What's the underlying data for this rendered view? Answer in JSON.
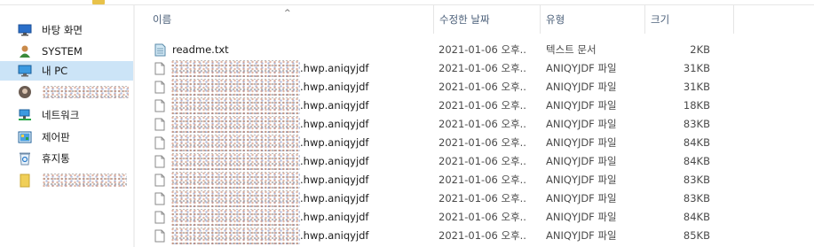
{
  "nav": {
    "items": [
      {
        "label": "바탕 화면",
        "icon": "desktop-icon",
        "selected": false
      },
      {
        "label": "SYSTEM",
        "icon": "user-icon",
        "selected": false
      },
      {
        "label": "내 PC",
        "icon": "computer-icon",
        "selected": true
      },
      {
        "label": "",
        "icon": "profile-icon",
        "selected": false,
        "redacted": true
      },
      {
        "label": "네트워크",
        "icon": "network-icon",
        "selected": false
      },
      {
        "label": "제어판",
        "icon": "control-panel-icon",
        "selected": false
      },
      {
        "label": "휴지통",
        "icon": "recycle-bin-icon",
        "selected": false
      },
      {
        "label": "",
        "icon": "folder-icon",
        "selected": false,
        "redacted": true
      }
    ]
  },
  "header": {
    "name": "이름",
    "date": "수정한 날짜",
    "type": "유형",
    "size": "크기",
    "sort_indicator": "^"
  },
  "files": [
    {
      "name": "readme.txt",
      "ext": "",
      "redacted": false,
      "date": "2021-01-06 오후...",
      "type": "텍스트 문서",
      "size": "2KB",
      "icon": "text-file-icon"
    },
    {
      "name": "",
      "ext": ".hwp.aniqyjdf",
      "redacted": true,
      "date": "2021-01-06 오후...",
      "type": "ANIQYJDF 파일",
      "size": "31KB",
      "icon": "blank-file-icon"
    },
    {
      "name": "",
      "ext": ".hwp.aniqyjdf",
      "redacted": true,
      "date": "2021-01-06 오후...",
      "type": "ANIQYJDF 파일",
      "size": "31KB",
      "icon": "blank-file-icon"
    },
    {
      "name": "",
      "ext": ".hwp.aniqyjdf",
      "redacted": true,
      "date": "2021-01-06 오후...",
      "type": "ANIQYJDF 파일",
      "size": "18KB",
      "icon": "blank-file-icon"
    },
    {
      "name": "",
      "ext": ".hwp.aniqyjdf",
      "redacted": true,
      "date": "2021-01-06 오후...",
      "type": "ANIQYJDF 파일",
      "size": "83KB",
      "icon": "blank-file-icon"
    },
    {
      "name": "",
      "ext": ".hwp.aniqyjdf",
      "redacted": true,
      "date": "2021-01-06 오후...",
      "type": "ANIQYJDF 파일",
      "size": "84KB",
      "icon": "blank-file-icon"
    },
    {
      "name": "",
      "ext": ".hwp.aniqyjdf",
      "redacted": true,
      "date": "2021-01-06 오후...",
      "type": "ANIQYJDF 파일",
      "size": "84KB",
      "icon": "blank-file-icon"
    },
    {
      "name": "",
      "ext": ".hwp.aniqyjdf",
      "redacted": true,
      "date": "2021-01-06 오후...",
      "type": "ANIQYJDF 파일",
      "size": "83KB",
      "icon": "blank-file-icon"
    },
    {
      "name": "",
      "ext": ".hwp.aniqyjdf",
      "redacted": true,
      "date": "2021-01-06 오후...",
      "type": "ANIQYJDF 파일",
      "size": "83KB",
      "icon": "blank-file-icon"
    },
    {
      "name": "",
      "ext": ".hwp.aniqyjdf",
      "redacted": true,
      "date": "2021-01-06 오후...",
      "type": "ANIQYJDF 파일",
      "size": "84KB",
      "icon": "blank-file-icon"
    },
    {
      "name": "",
      "ext": ".hwp.aniqyjdf",
      "redacted": true,
      "date": "2021-01-06 오후...",
      "type": "ANIQYJDF 파일",
      "size": "85KB",
      "icon": "blank-file-icon"
    }
  ],
  "colors": {
    "selection": "#cce4f7",
    "header_text": "#4c607a",
    "folder": "#e8c24a"
  }
}
